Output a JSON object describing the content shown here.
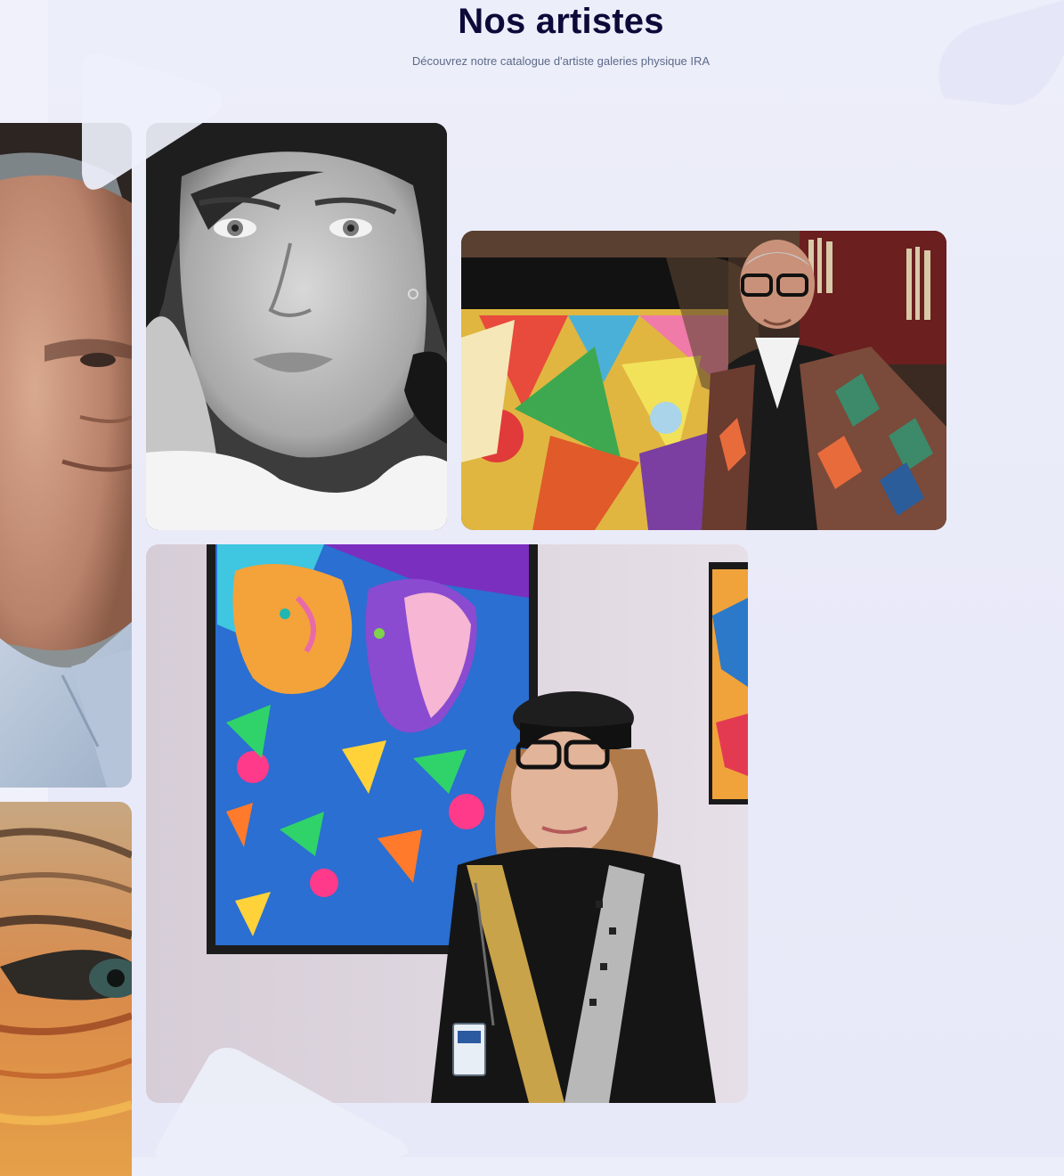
{
  "section": {
    "title": "Nos artistes",
    "subtitle": "Découvrez notre catalogue d'artiste galeries physique IRA"
  },
  "gallery": {
    "cards": [
      {
        "description": "Portrait of a man in a light blue shirt (partially visible)"
      },
      {
        "description": "Black and white portrait of a woman resting chin on hand"
      },
      {
        "description": "Older man with glasses beside a colorful geometric painting"
      },
      {
        "description": "Close-up painting of an eye with orange wrinkles (partially visible)"
      },
      {
        "description": "Woman in black beret standing beside a colorful abstract face painting"
      }
    ]
  },
  "colors": {
    "background": "#eceef9",
    "title": "#0d0a3a",
    "subtitle": "#5d6a8a"
  }
}
